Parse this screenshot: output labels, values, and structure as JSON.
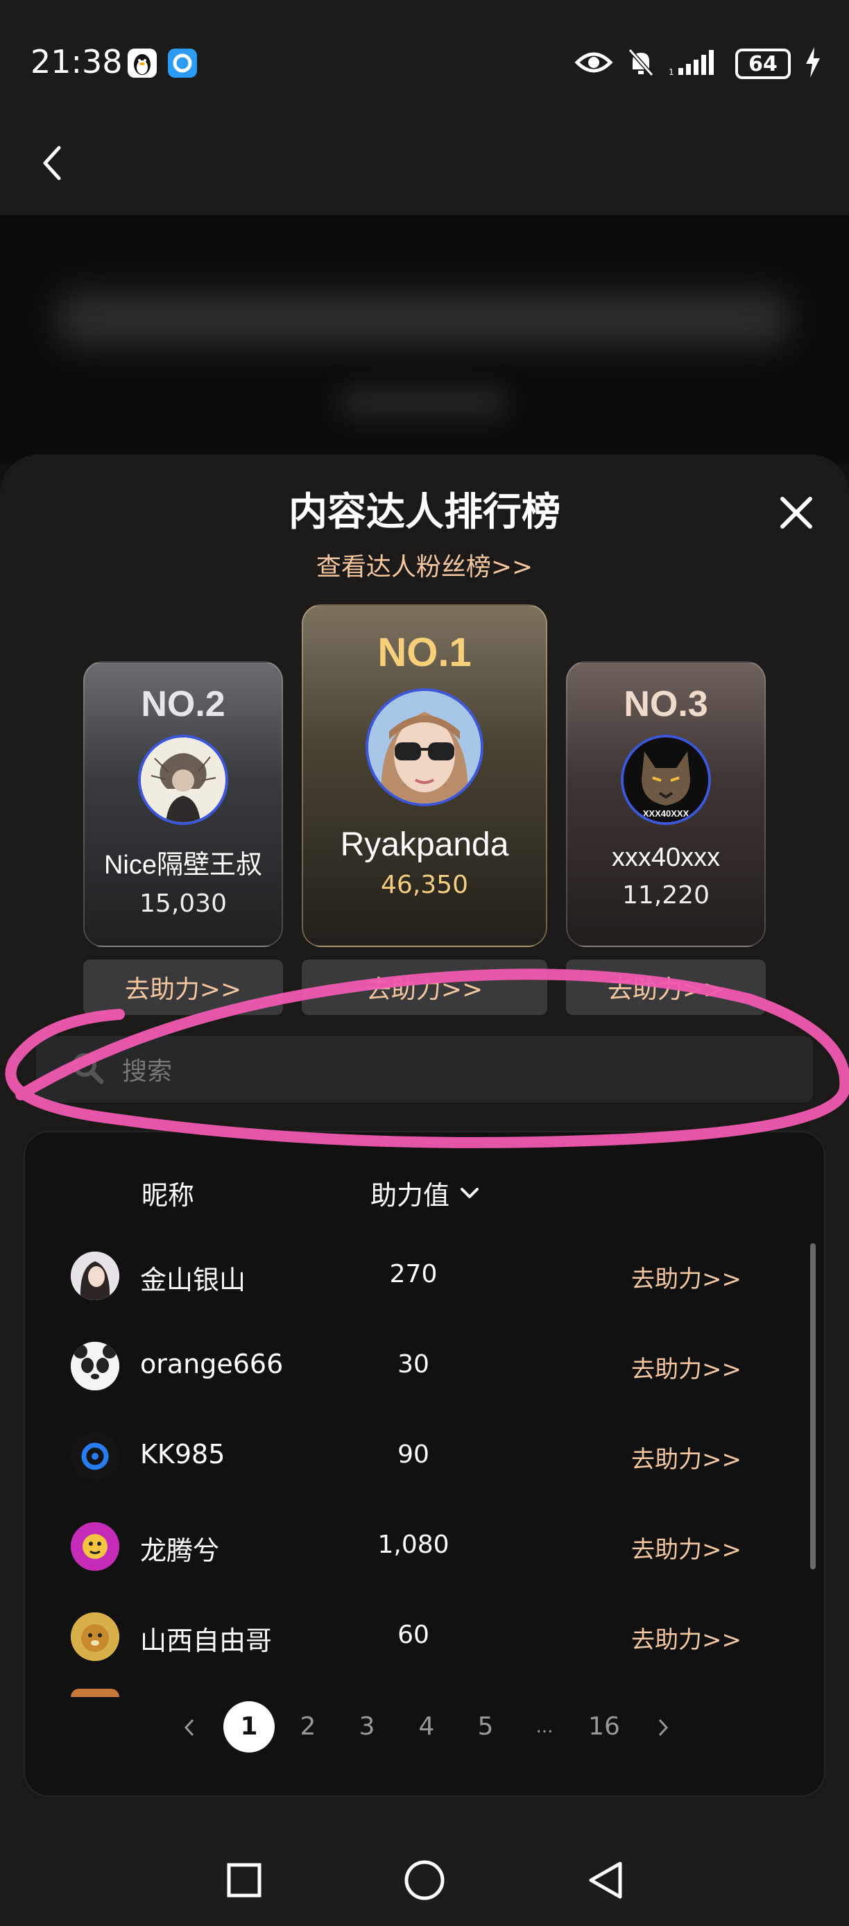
{
  "status_bar": {
    "time": "21:38",
    "battery": "64"
  },
  "modal": {
    "title": "内容达人排行榜",
    "fans_link": "查看达人粉丝榜>>"
  },
  "podium": [
    {
      "rank": "NO.2",
      "name": "Nice隔壁王叔",
      "score": "15,030",
      "boost": "去助力>>"
    },
    {
      "rank": "NO.1",
      "name": "Ryakpanda",
      "score": "46,350",
      "boost": "去助力>>"
    },
    {
      "rank": "NO.3",
      "name": "xxx40xxx",
      "score": "11,220",
      "boost": "去助力>>",
      "avatar_text": "XXX40XXX"
    }
  ],
  "search": {
    "placeholder": "搜索"
  },
  "table": {
    "col_nickname": "昵称",
    "col_score": "助力值",
    "rows": [
      {
        "name": "金山银山",
        "score": "270",
        "action": "去助力>>"
      },
      {
        "name": "orange666",
        "score": "30",
        "action": "去助力>>"
      },
      {
        "name": "KK985",
        "score": "90",
        "action": "去助力>>"
      },
      {
        "name": "龙腾兮",
        "score": "1,080",
        "action": "去助力>>"
      },
      {
        "name": "山西自由哥",
        "score": "60",
        "action": "去助力>>"
      }
    ]
  },
  "pagination": {
    "pages": [
      "1",
      "2",
      "3",
      "4",
      "5",
      "...",
      "16"
    ],
    "current": "1"
  },
  "colors": {
    "accent_peach": "#f4c7a0",
    "gold": "#f8cf7a",
    "annotation_pink": "#f05ab0"
  }
}
